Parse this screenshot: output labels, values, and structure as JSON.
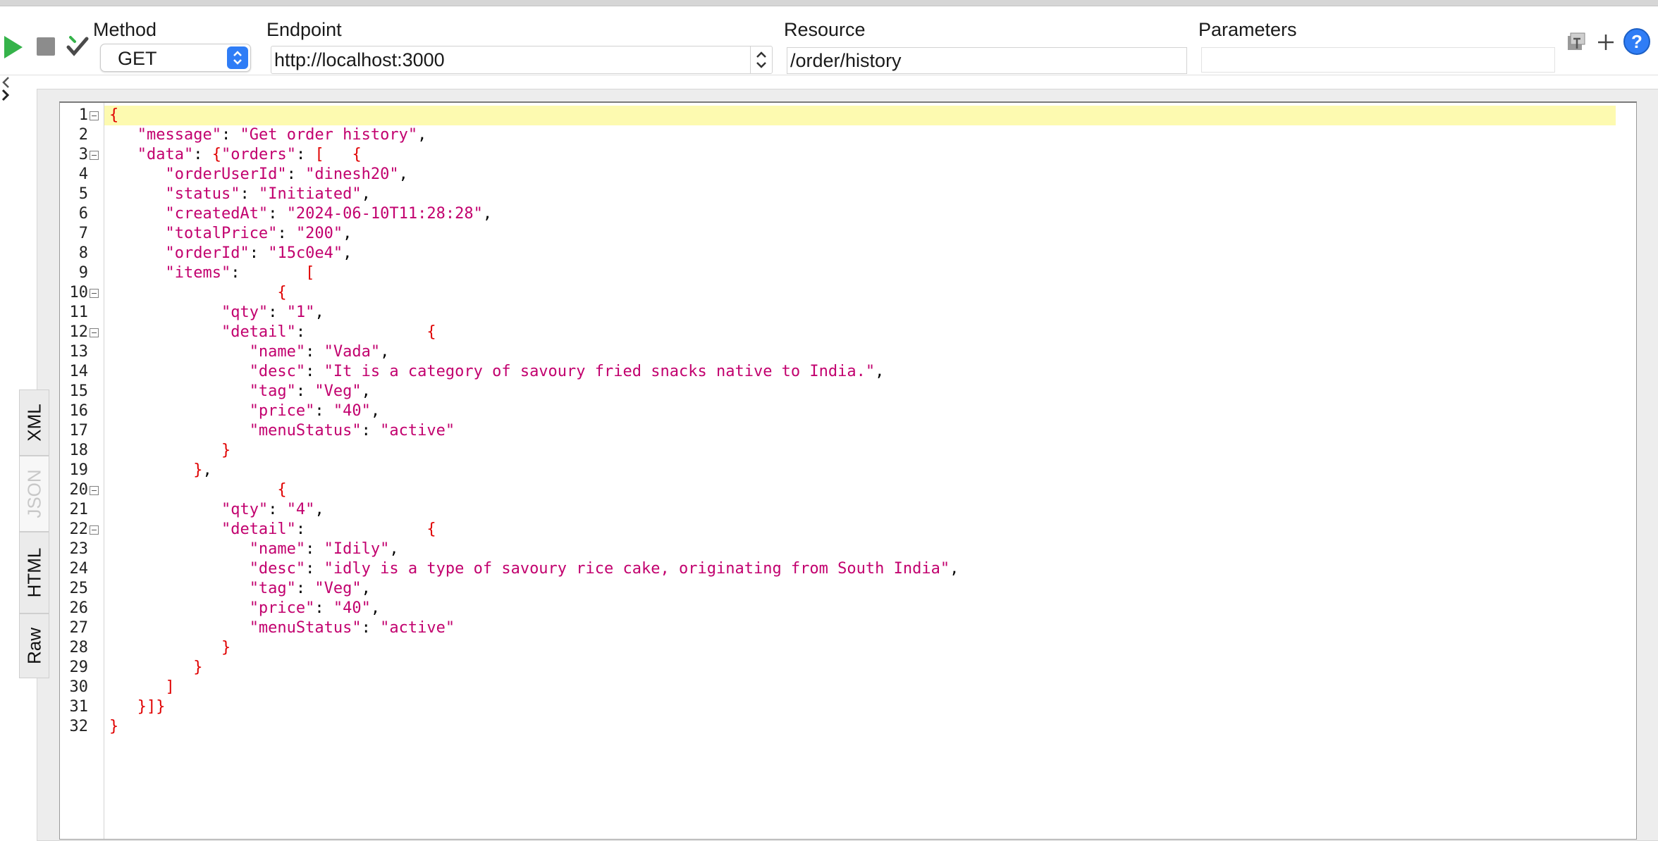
{
  "toolbar": {
    "method_label": "Method",
    "method_value": "GET",
    "endpoint_label": "Endpoint",
    "endpoint_value": "http://localhost:3000",
    "resource_label": "Resource",
    "resource_value": "/order/history",
    "parameters_label": "Parameters",
    "parameters_value": "",
    "icons": [
      "run-icon",
      "stop-icon",
      "check-icon",
      "clear-icon",
      "add-icon",
      "help-icon"
    ],
    "colors": {
      "run": "#35b34a",
      "help": "#2f7df6",
      "spinner": "#2f7df6"
    }
  },
  "tabs": [
    "XML",
    "JSON",
    "HTML",
    "Raw"
  ],
  "selected_tab": "JSON",
  "editor": {
    "colors": {
      "key_string": "#c2006e",
      "punctuation": "#e00000",
      "highlight": "#fdfab0"
    },
    "lines": [
      {
        "n": "1",
        "fold": true,
        "segs": [
          [
            "p",
            "{"
          ]
        ]
      },
      {
        "n": "2",
        "fold": false,
        "segs": [
          [
            "t",
            "   "
          ],
          [
            "k",
            "\"message\""
          ],
          [
            "t",
            ": "
          ],
          [
            "k",
            "\"Get order history\""
          ],
          [
            "t",
            ","
          ]
        ]
      },
      {
        "n": "3",
        "fold": true,
        "segs": [
          [
            "t",
            "   "
          ],
          [
            "k",
            "\"data\""
          ],
          [
            "t",
            ": "
          ],
          [
            "p",
            "{"
          ],
          [
            "k",
            "\"orders\""
          ],
          [
            "t",
            ": "
          ],
          [
            "p",
            "["
          ],
          [
            "t",
            "   "
          ],
          [
            "p",
            "{"
          ]
        ]
      },
      {
        "n": "4",
        "fold": false,
        "segs": [
          [
            "t",
            "      "
          ],
          [
            "k",
            "\"orderUserId\""
          ],
          [
            "t",
            ": "
          ],
          [
            "k",
            "\"dinesh20\""
          ],
          [
            "t",
            ","
          ]
        ]
      },
      {
        "n": "5",
        "fold": false,
        "segs": [
          [
            "t",
            "      "
          ],
          [
            "k",
            "\"status\""
          ],
          [
            "t",
            ": "
          ],
          [
            "k",
            "\"Initiated\""
          ],
          [
            "t",
            ","
          ]
        ]
      },
      {
        "n": "6",
        "fold": false,
        "segs": [
          [
            "t",
            "      "
          ],
          [
            "k",
            "\"createdAt\""
          ],
          [
            "t",
            ": "
          ],
          [
            "k",
            "\"2024-06-10T11:28:28\""
          ],
          [
            "t",
            ","
          ]
        ]
      },
      {
        "n": "7",
        "fold": false,
        "segs": [
          [
            "t",
            "      "
          ],
          [
            "k",
            "\"totalPrice\""
          ],
          [
            "t",
            ": "
          ],
          [
            "k",
            "\"200\""
          ],
          [
            "t",
            ","
          ]
        ]
      },
      {
        "n": "8",
        "fold": false,
        "segs": [
          [
            "t",
            "      "
          ],
          [
            "k",
            "\"orderId\""
          ],
          [
            "t",
            ": "
          ],
          [
            "k",
            "\"15c0e4\""
          ],
          [
            "t",
            ","
          ]
        ]
      },
      {
        "n": "9",
        "fold": false,
        "segs": [
          [
            "t",
            "      "
          ],
          [
            "k",
            "\"items\""
          ],
          [
            "t",
            ":       "
          ],
          [
            "p",
            "["
          ]
        ]
      },
      {
        "n": "10",
        "fold": true,
        "segs": [
          [
            "t",
            "                  "
          ],
          [
            "p",
            "{"
          ]
        ]
      },
      {
        "n": "11",
        "fold": false,
        "segs": [
          [
            "t",
            "            "
          ],
          [
            "k",
            "\"qty\""
          ],
          [
            "t",
            ": "
          ],
          [
            "k",
            "\"1\""
          ],
          [
            "t",
            ","
          ]
        ]
      },
      {
        "n": "12",
        "fold": true,
        "segs": [
          [
            "t",
            "            "
          ],
          [
            "k",
            "\"detail\""
          ],
          [
            "t",
            ":             "
          ],
          [
            "p",
            "{"
          ]
        ]
      },
      {
        "n": "13",
        "fold": false,
        "segs": [
          [
            "t",
            "               "
          ],
          [
            "k",
            "\"name\""
          ],
          [
            "t",
            ": "
          ],
          [
            "k",
            "\"Vada\""
          ],
          [
            "t",
            ","
          ]
        ]
      },
      {
        "n": "14",
        "fold": false,
        "segs": [
          [
            "t",
            "               "
          ],
          [
            "k",
            "\"desc\""
          ],
          [
            "t",
            ": "
          ],
          [
            "k",
            "\"It is a category of savoury fried snacks native to India.\""
          ],
          [
            "t",
            ","
          ]
        ]
      },
      {
        "n": "15",
        "fold": false,
        "segs": [
          [
            "t",
            "               "
          ],
          [
            "k",
            "\"tag\""
          ],
          [
            "t",
            ": "
          ],
          [
            "k",
            "\"Veg\""
          ],
          [
            "t",
            ","
          ]
        ]
      },
      {
        "n": "16",
        "fold": false,
        "segs": [
          [
            "t",
            "               "
          ],
          [
            "k",
            "\"price\""
          ],
          [
            "t",
            ": "
          ],
          [
            "k",
            "\"40\""
          ],
          [
            "t",
            ","
          ]
        ]
      },
      {
        "n": "17",
        "fold": false,
        "segs": [
          [
            "t",
            "               "
          ],
          [
            "k",
            "\"menuStatus\""
          ],
          [
            "t",
            ": "
          ],
          [
            "k",
            "\"active\""
          ]
        ]
      },
      {
        "n": "18",
        "fold": false,
        "segs": [
          [
            "t",
            "            "
          ],
          [
            "p",
            "}"
          ]
        ]
      },
      {
        "n": "19",
        "fold": false,
        "segs": [
          [
            "t",
            "         "
          ],
          [
            "p",
            "}"
          ],
          [
            "t",
            ","
          ]
        ]
      },
      {
        "n": "20",
        "fold": true,
        "segs": [
          [
            "t",
            "                  "
          ],
          [
            "p",
            "{"
          ]
        ]
      },
      {
        "n": "21",
        "fold": false,
        "segs": [
          [
            "t",
            "            "
          ],
          [
            "k",
            "\"qty\""
          ],
          [
            "t",
            ": "
          ],
          [
            "k",
            "\"4\""
          ],
          [
            "t",
            ","
          ]
        ]
      },
      {
        "n": "22",
        "fold": true,
        "segs": [
          [
            "t",
            "            "
          ],
          [
            "k",
            "\"detail\""
          ],
          [
            "t",
            ":             "
          ],
          [
            "p",
            "{"
          ]
        ]
      },
      {
        "n": "23",
        "fold": false,
        "segs": [
          [
            "t",
            "               "
          ],
          [
            "k",
            "\"name\""
          ],
          [
            "t",
            ": "
          ],
          [
            "k",
            "\"Idily\""
          ],
          [
            "t",
            ","
          ]
        ]
      },
      {
        "n": "24",
        "fold": false,
        "segs": [
          [
            "t",
            "               "
          ],
          [
            "k",
            "\"desc\""
          ],
          [
            "t",
            ": "
          ],
          [
            "k",
            "\"idly is a type of savoury rice cake, originating from South India\""
          ],
          [
            "t",
            ","
          ]
        ]
      },
      {
        "n": "25",
        "fold": false,
        "segs": [
          [
            "t",
            "               "
          ],
          [
            "k",
            "\"tag\""
          ],
          [
            "t",
            ": "
          ],
          [
            "k",
            "\"Veg\""
          ],
          [
            "t",
            ","
          ]
        ]
      },
      {
        "n": "26",
        "fold": false,
        "segs": [
          [
            "t",
            "               "
          ],
          [
            "k",
            "\"price\""
          ],
          [
            "t",
            ": "
          ],
          [
            "k",
            "\"40\""
          ],
          [
            "t",
            ","
          ]
        ]
      },
      {
        "n": "27",
        "fold": false,
        "segs": [
          [
            "t",
            "               "
          ],
          [
            "k",
            "\"menuStatus\""
          ],
          [
            "t",
            ": "
          ],
          [
            "k",
            "\"active\""
          ]
        ]
      },
      {
        "n": "28",
        "fold": false,
        "segs": [
          [
            "t",
            "            "
          ],
          [
            "p",
            "}"
          ]
        ]
      },
      {
        "n": "29",
        "fold": false,
        "segs": [
          [
            "t",
            "         "
          ],
          [
            "p",
            "}"
          ]
        ]
      },
      {
        "n": "30",
        "fold": false,
        "segs": [
          [
            "t",
            "      "
          ],
          [
            "p",
            "]"
          ]
        ]
      },
      {
        "n": "31",
        "fold": false,
        "segs": [
          [
            "t",
            "   "
          ],
          [
            "p",
            "}]}"
          ]
        ]
      },
      {
        "n": "32",
        "fold": false,
        "segs": [
          [
            "p",
            "}"
          ]
        ]
      }
    ]
  }
}
